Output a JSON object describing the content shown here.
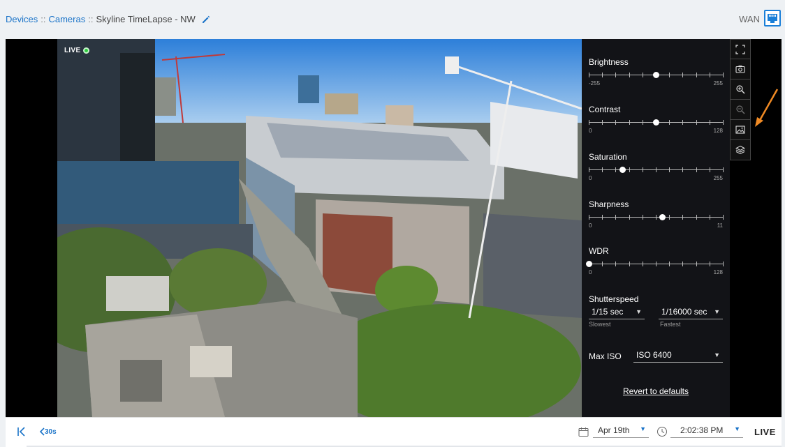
{
  "header": {
    "breadcrumb": [
      {
        "label": "Devices",
        "link": true
      },
      {
        "label": "Cameras",
        "link": true
      },
      {
        "label": "Skyline TimeLapse - NW",
        "link": false
      }
    ],
    "separator": "::",
    "network_label": "WAN"
  },
  "video": {
    "live_badge": "LIVE"
  },
  "settings": {
    "sliders": [
      {
        "label": "Brightness",
        "min": "-255",
        "max": "255",
        "value": 0,
        "range_min": -255,
        "range_max": 255
      },
      {
        "label": "Contrast",
        "min": "0",
        "max": "128",
        "value": 64,
        "range_min": 0,
        "range_max": 128
      },
      {
        "label": "Saturation",
        "min": "0",
        "max": "255",
        "value": 64,
        "range_min": 0,
        "range_max": 255
      },
      {
        "label": "Sharpness",
        "min": "0",
        "max": "11",
        "value": 6,
        "range_min": 0,
        "range_max": 11
      },
      {
        "label": "WDR",
        "min": "0",
        "max": "128",
        "value": 0,
        "range_min": 0,
        "range_max": 128
      }
    ],
    "shutterspeed": {
      "label": "Shutterspeed",
      "slowest_value": "1/15 sec",
      "fastest_value": "1/16000 sec",
      "slowest_label": "Slowest",
      "fastest_label": "Fastest"
    },
    "max_iso": {
      "label": "Max ISO",
      "value": "ISO 6400"
    },
    "revert_label": "Revert to defaults"
  },
  "toolbar": {
    "icons": [
      "fullscreen-icon",
      "camera-snapshot-icon",
      "zoom-in-icon",
      "zoom-out-icon",
      "image-settings-icon",
      "layers-icon"
    ]
  },
  "annotation_color": "#f08a24",
  "bottom": {
    "back_label": "30s",
    "date": "Apr 19th",
    "time": "2:02:38 PM",
    "live_label": "LIVE"
  },
  "colors": {
    "accent": "#1a73c8",
    "live_dot": "#2ecc40"
  }
}
